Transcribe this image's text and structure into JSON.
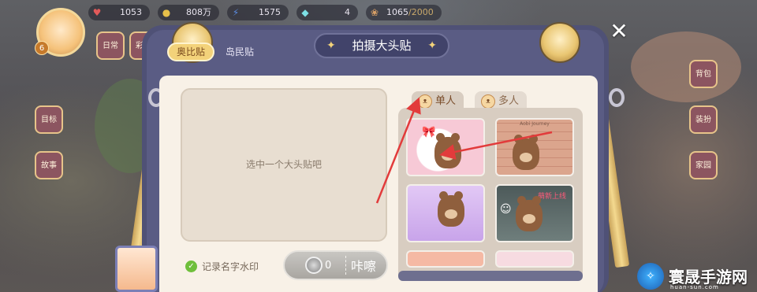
{
  "hud": {
    "items": [
      {
        "value": "1053",
        "color": "#e25a5a",
        "icon": "heart-icon"
      },
      {
        "value": "808万",
        "color": "#e7c04a",
        "icon": "coin-icon"
      },
      {
        "value": "1575",
        "color": "#5b8be0",
        "icon": "energy-icon"
      },
      {
        "value": "4",
        "color": "#7de0e6",
        "icon": "gem-icon"
      },
      {
        "value": "1065",
        "cap": "/2000",
        "color": "#d9a066",
        "icon": "hamster-icon"
      }
    ]
  },
  "avatar": {
    "level": "6"
  },
  "side_buttons": [
    {
      "label": "日常",
      "icon": "shop-icon"
    },
    {
      "label": "彩蛋",
      "icon": "egg-icon"
    },
    {
      "label": "目标",
      "icon": "target-icon"
    },
    {
      "label": "故事",
      "icon": "story-book-icon"
    }
  ],
  "right_buttons": [
    {
      "label": "背包",
      "icon": "backpack-icon"
    },
    {
      "label": "装扮",
      "icon": "outfit-icon"
    },
    {
      "label": "家园",
      "icon": "home-icon"
    }
  ],
  "dialog": {
    "title": "拍摄大头贴",
    "tabs": [
      {
        "label": "奥比贴",
        "active": true
      },
      {
        "label": "岛民贴",
        "active": false
      }
    ],
    "placeholder": "选中一个大头贴吧",
    "watermark_label": "记录名字水印",
    "shoot": {
      "cost": "0",
      "label": "咔嚓"
    },
    "sticker_tabs": [
      {
        "label": "单人",
        "active": true
      },
      {
        "label": "多人",
        "active": false
      }
    ],
    "stickers": [
      {
        "name": "pink-bow-sticker",
        "bg": "#f7c9d6",
        "deco": ""
      },
      {
        "name": "brick-wall-sticker",
        "bg": "#d79a83",
        "deco": "Aobi Journey"
      },
      {
        "name": "purple-cloud-sticker",
        "bg": "#d6b9ef",
        "deco": ""
      },
      {
        "name": "spooky-night-sticker",
        "bg": "#5c6c6a",
        "deco": "萌新上线"
      },
      {
        "name": "peach-sticker",
        "bg": "#f5b9a4",
        "deco": ""
      },
      {
        "name": "comic-sticker",
        "bg": "#f7dbe1",
        "deco": ""
      }
    ]
  },
  "logo": {
    "title": "寰晟手游网",
    "sub": "huan-sun.com"
  }
}
